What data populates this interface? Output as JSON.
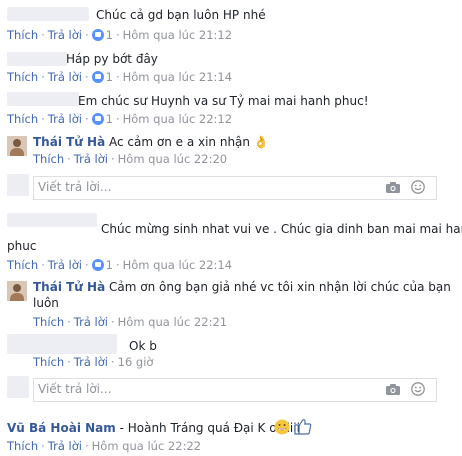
{
  "actions": {
    "like": "Thích",
    "reply": "Trả lời",
    "separator": "·"
  },
  "reply_placeholder": "Viết trả lời...",
  "comments": [
    {
      "text": "Chúc cả gd bạn luôn HP nhé",
      "reaction_count": "1",
      "time": "Hôm qua lúc 21:12"
    },
    {
      "text": "Háp py bớt đây",
      "reaction_count": "1",
      "time": "Hôm qua lúc 21:14"
    },
    {
      "text": "Em chúc sư Huynh va sư Tỷ mai mai hanh phuc!",
      "reaction_count": "1",
      "time": "Hôm qua lúc 22:12"
    },
    {
      "author": "Thái Tử Hà",
      "text": "Ac cảm ơn e a xin nhận",
      "time": "Hôm qua lúc 22:20",
      "emoji": "👌"
    },
    {
      "text_line1": "Chúc mừng sinh nhat vui ve . Chúc gia dinh ban mai mai hanh",
      "text_line2": "phuc",
      "reaction_count": "1",
      "time": "Hôm qua lúc 22:14"
    },
    {
      "author": "Thái Tử Hà",
      "text_line1": "Cảm ơn ông bạn giả nhé vc tôi xin nhận lời chúc của bạn",
      "text_line2": "luôn",
      "time": "Hôm qua lúc 22:21"
    },
    {
      "text": "Ok b",
      "time": "16 giờ"
    },
    {
      "author": "Vũ Bá Hoài Nam",
      "text": "- Hoành Tráng quá Đại K ơiiiiiii",
      "time": "Hôm qua lúc 22:22"
    }
  ],
  "icons": {
    "like_reaction": "like-reaction-icon",
    "camera": "camera-icon",
    "emoji": "emoji-icon"
  },
  "colors": {
    "link": "#4267b2",
    "name": "#365899",
    "meta": "#90949c",
    "like_blue": "#5890ff"
  }
}
